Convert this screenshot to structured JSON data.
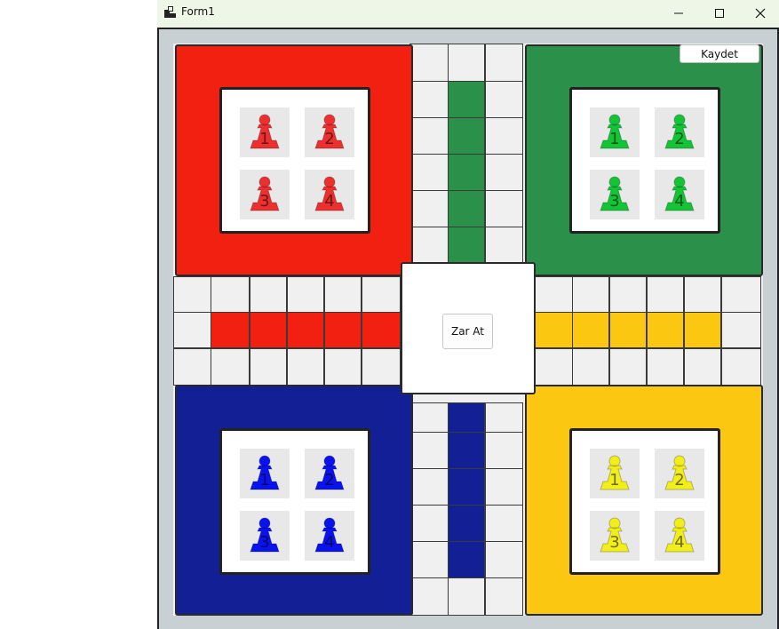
{
  "window": {
    "title": "Form1",
    "controls": {
      "minimize": "minimize-icon",
      "maximize": "maximize-icon",
      "close": "close-icon"
    }
  },
  "buttons": {
    "save_label": "Kaydet",
    "roll_label": "Zar At"
  },
  "colors": {
    "red": "#f22010",
    "green": "#2b914a",
    "blue": "#131f94",
    "yellow": "#fcc711",
    "red_pawn": "#ee2f2f",
    "green_pawn": "#12c436",
    "blue_pawn": "#0a13ee",
    "yellow_pawn": "#f2ee1a"
  },
  "homes": [
    {
      "color": "red",
      "pawns": [
        "1",
        "2",
        "3",
        "4"
      ]
    },
    {
      "color": "green",
      "pawns": [
        "1",
        "2",
        "3",
        "4"
      ]
    },
    {
      "color": "blue",
      "pawns": [
        "1",
        "2",
        "3",
        "4"
      ]
    },
    {
      "color": "yellow",
      "pawns": [
        "1",
        "2",
        "3",
        "4"
      ]
    }
  ]
}
